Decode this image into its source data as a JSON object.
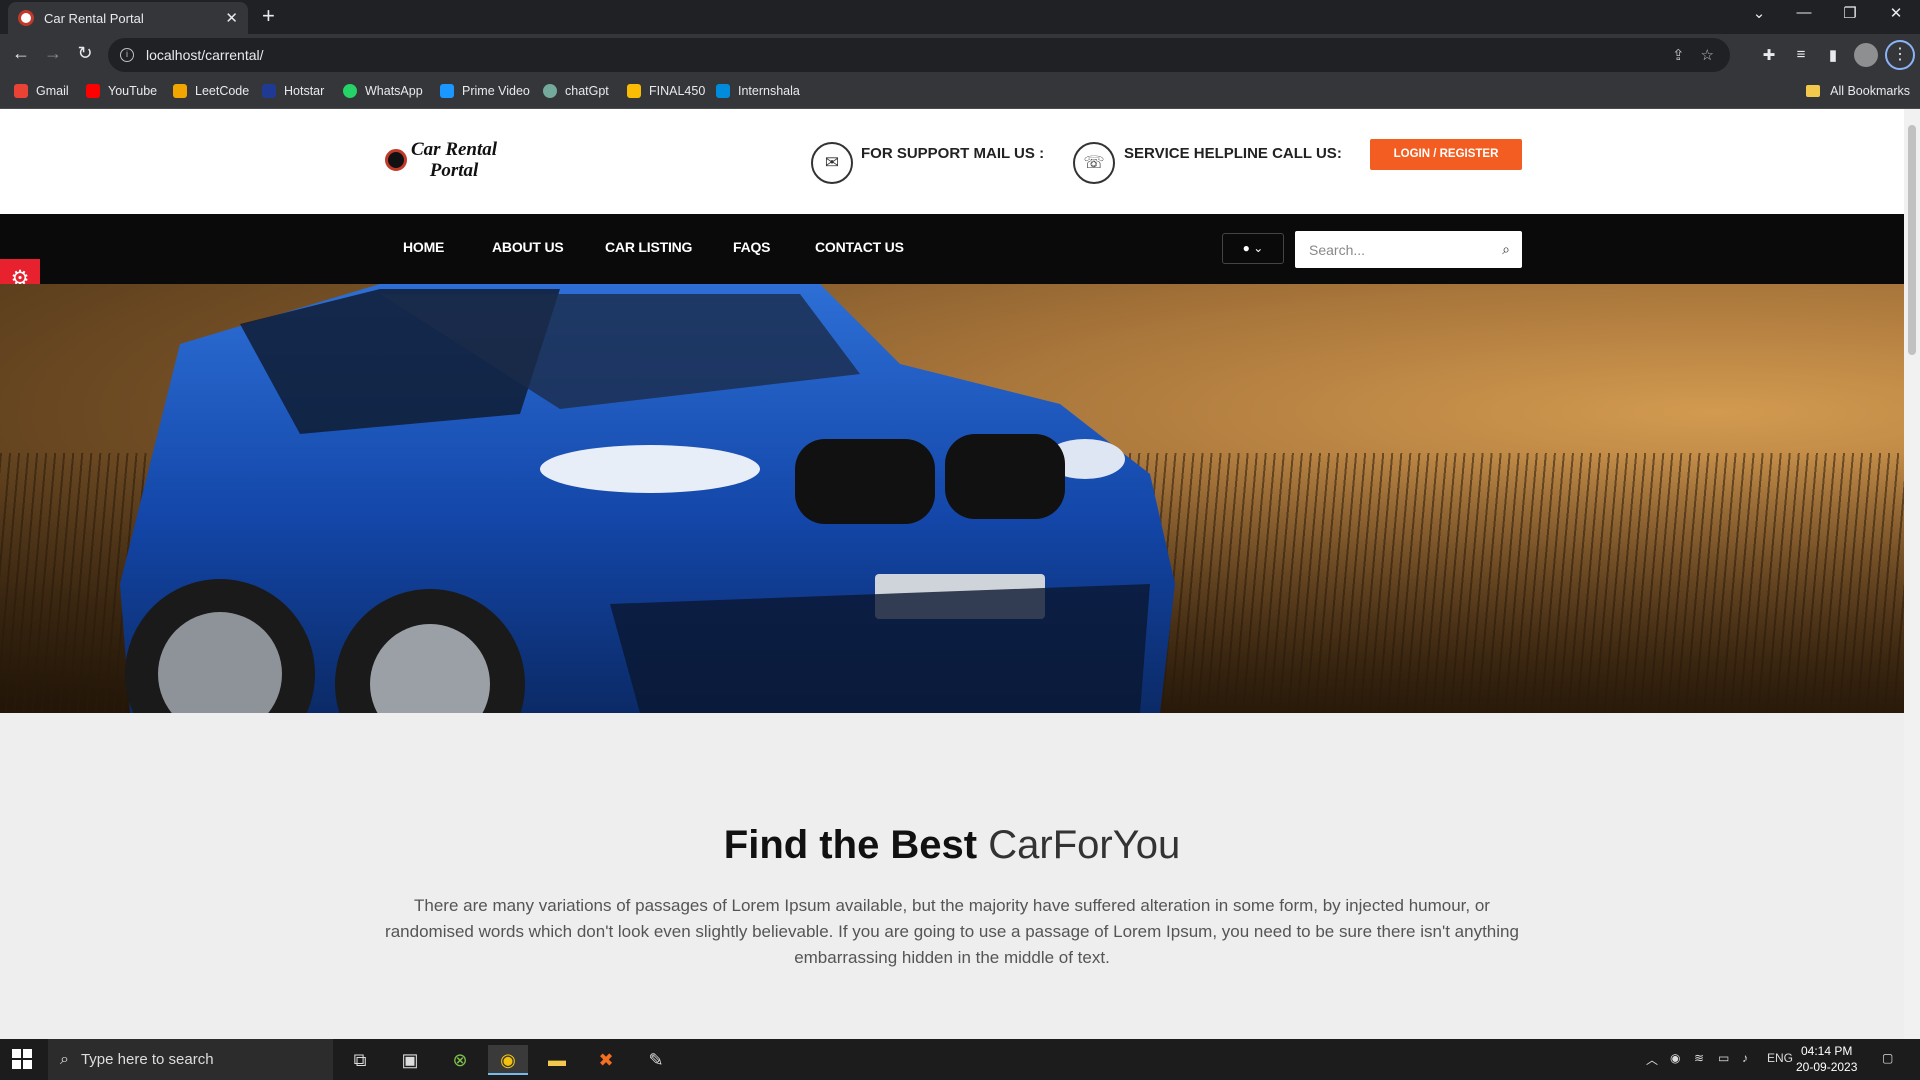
{
  "browser": {
    "tab_title": "Car Rental Portal",
    "url": "localhost/carrental/",
    "bookmarks": [
      {
        "label": "Gmail",
        "color": "#ea4335"
      },
      {
        "label": "YouTube",
        "color": "#ff0000"
      },
      {
        "label": "LeetCode",
        "color": "#f0a500"
      },
      {
        "label": "Hotstar",
        "color": "#1f3a93"
      },
      {
        "label": "WhatsApp",
        "color": "#25d366"
      },
      {
        "label": "Prime Video",
        "color": "#1a98ff"
      },
      {
        "label": "chatGpt",
        "color": "#74aa9c"
      },
      {
        "label": "FINAL450",
        "color": "#fbbc05"
      },
      {
        "label": "Internshala",
        "color": "#008bdc"
      }
    ],
    "all_bookmarks_label": "All Bookmarks"
  },
  "site": {
    "logo_line1": "Car Rental",
    "logo_line2": "Portal",
    "support_mail_label": "FOR SUPPORT MAIL US :",
    "helpline_label": "SERVICE HELPLINE CALL US:",
    "login_button": "LOGIN / REGISTER",
    "nav": [
      "HOME",
      "ABOUT US",
      "CAR LISTING",
      "FAQS",
      "CONTACT US"
    ],
    "search_placeholder": "Search...",
    "headline_bold": "Find the Best",
    "headline_light": "CarForYou",
    "intro": "There are many variations of passages of Lorem Ipsum available, but the majority have suffered alteration in some form, by injected humour, or randomised words which don't look even slightly believable. If you are going to use a passage of Lorem Ipsum, you need to be sure there isn't anything embarrassing hidden in the middle of text.",
    "accent_color": "#f35d22"
  },
  "taskbar": {
    "search_placeholder": "Type here to search",
    "language": "ENG",
    "time": "04:14 PM",
    "date": "20-09-2023"
  }
}
